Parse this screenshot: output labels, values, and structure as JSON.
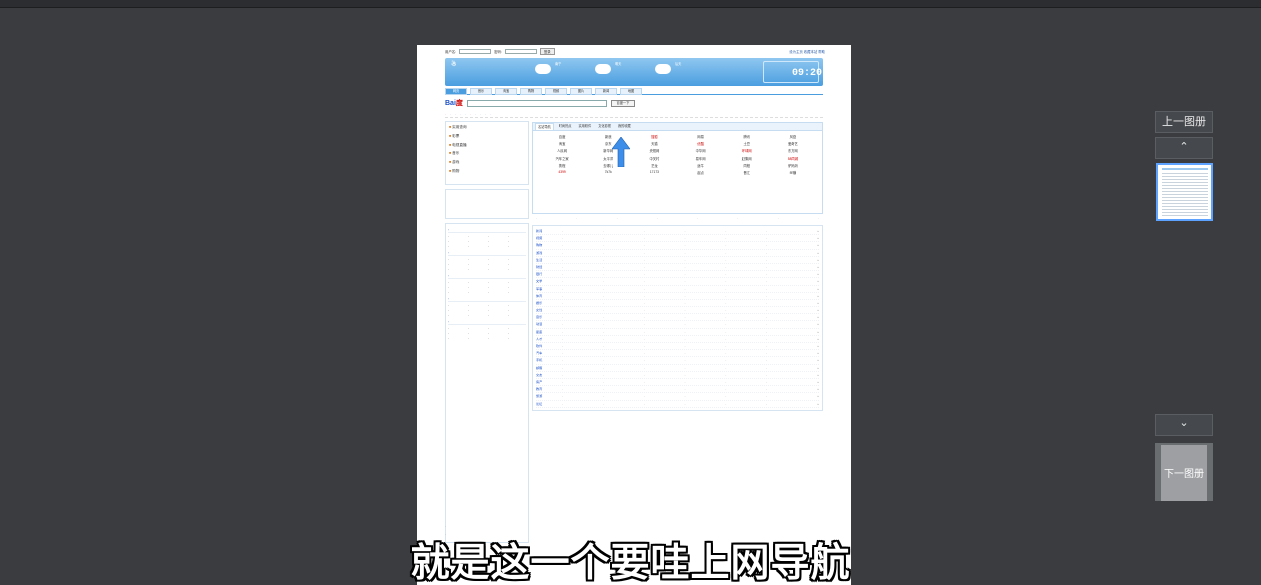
{
  "viewer": {
    "prev_label": "上一图册",
    "next_label": "下一图册",
    "up_icon": "chevron-up-icon",
    "down_icon": "chevron-down-icon"
  },
  "subtitle": "就是这一个要哇上网导航",
  "page": {
    "login_bar": {
      "user_label": "用户名:",
      "password_label": "密码:",
      "login_button": "登录",
      "right_links": "设为主页  收藏本站  帮助"
    },
    "header": {
      "weather_cities": [
        "南宁",
        "明天",
        "后天"
      ],
      "clock": "09:20"
    },
    "tabs": [
      "网页",
      "音乐",
      "淘宝",
      "购物",
      "视频",
      "图片",
      "新闻",
      "地图"
    ],
    "search_button": "百度一下",
    "sitebox_tabs": [
      "名站导航",
      "时尚热点",
      "实用软件",
      "文化影视",
      "我的收藏"
    ],
    "main_sites": [
      [
        "百度",
        "新浪",
        "搜狐",
        "网易",
        "腾讯",
        "凤凰"
      ],
      [
        "淘宝",
        "京东",
        "天猫",
        "优酷",
        "土豆",
        "爱奇艺"
      ],
      [
        "人民网",
        "新华网",
        "央视网",
        "中华网",
        "环球网",
        "东方网"
      ],
      [
        "汽车之家",
        "太平洋",
        "中关村",
        "易车网",
        "赶集网",
        "58同城"
      ],
      [
        "携程",
        "去哪儿",
        "艺龙",
        "途牛",
        "同程",
        "驴妈妈"
      ],
      [
        "4399",
        "7k7k",
        "17173",
        "起点",
        "晋江",
        "纵横"
      ]
    ],
    "left_menu": [
      "实用查询",
      "彩票",
      "电视直播",
      "音乐",
      "游戏",
      "购物"
    ],
    "category_rows": [
      "新闻",
      "视频",
      "购物",
      "游戏",
      "生活",
      "财经",
      "银行",
      "文学",
      "军事",
      "体育",
      "娱乐",
      "女性",
      "音乐",
      "动漫",
      "星座",
      "人才",
      "软件",
      "汽车",
      "手机",
      "邮箱",
      "交友",
      "房产",
      "教育",
      "旅游",
      "论坛"
    ]
  }
}
